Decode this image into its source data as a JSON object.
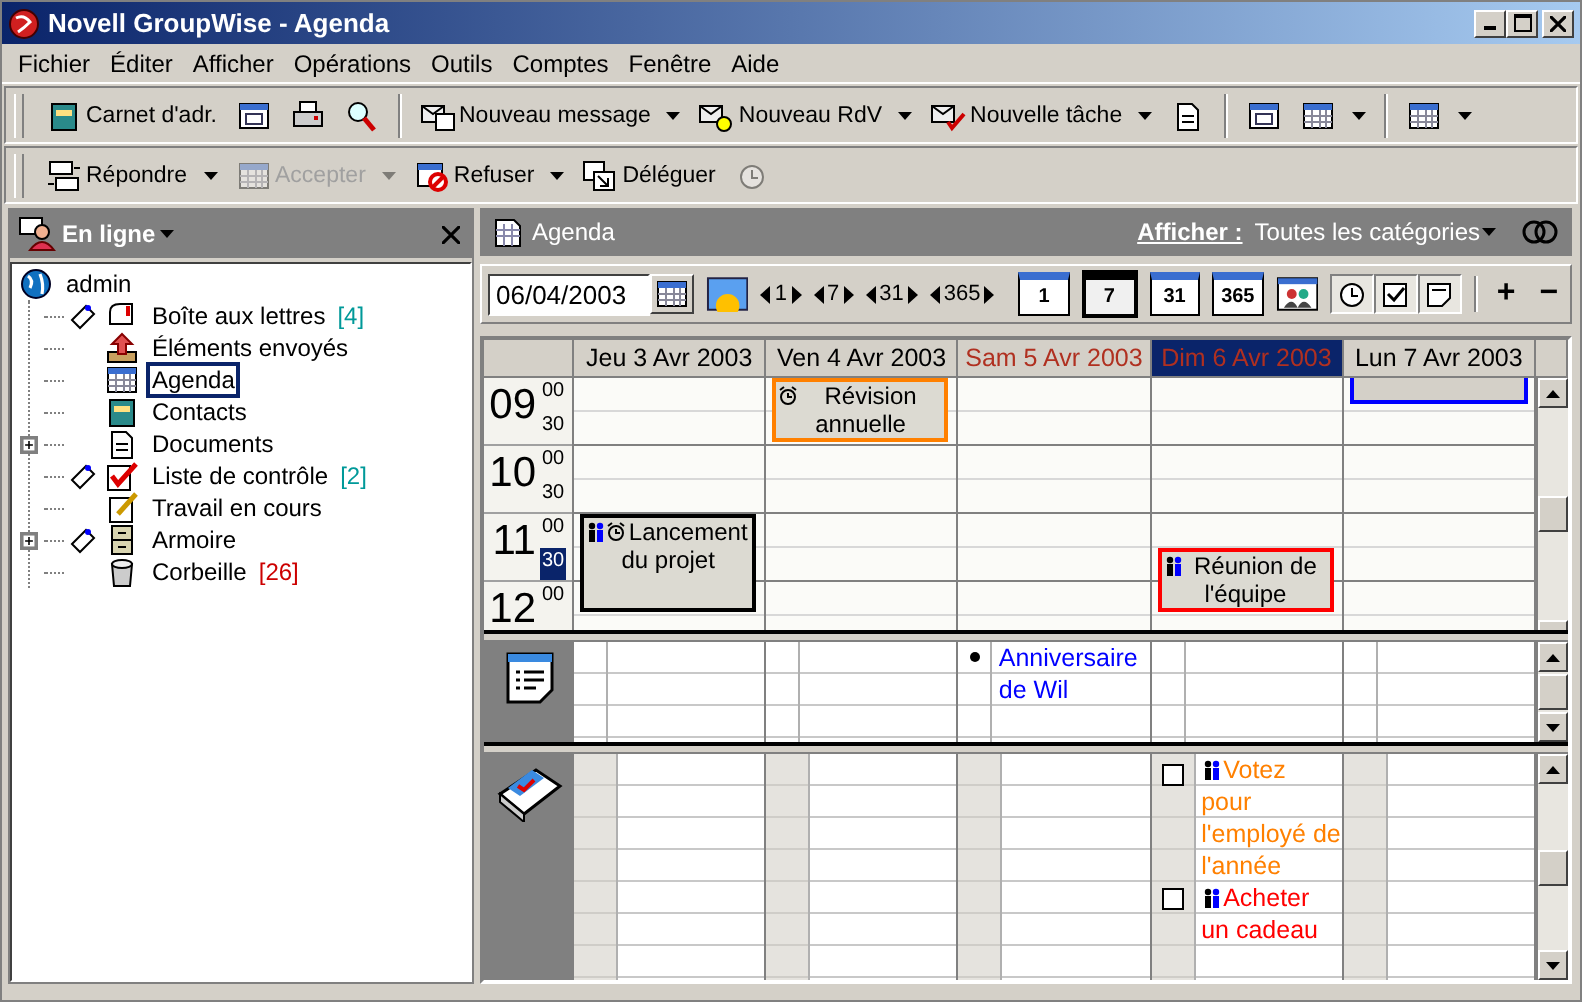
{
  "window": {
    "title": "Novell GroupWise - Agenda"
  },
  "menu": [
    "Fichier",
    "Éditer",
    "Afficher",
    "Opérations",
    "Outils",
    "Comptes",
    "Fenêtre",
    "Aide"
  ],
  "toolbar_1": [
    {
      "kind": "labeled",
      "label": "Carnet d'adr.",
      "dropdown": false
    },
    {
      "kind": "icon",
      "dropdown": false
    },
    {
      "kind": "icon",
      "dropdown": false
    },
    {
      "kind": "icon",
      "dropdown": false
    },
    {
      "kind": "separator"
    },
    {
      "kind": "labeled",
      "label": "Nouveau message",
      "dropdown": true
    },
    {
      "kind": "labeled",
      "label": "Nouveau RdV",
      "dropdown": true
    },
    {
      "kind": "labeled",
      "label": "Nouvelle tâche",
      "dropdown": true
    },
    {
      "kind": "icon",
      "dropdown": false
    },
    {
      "kind": "separator"
    },
    {
      "kind": "icon",
      "dropdown": false
    },
    {
      "kind": "icon",
      "dropdown": true
    },
    {
      "kind": "separator"
    },
    {
      "kind": "icon",
      "dropdown": true
    }
  ],
  "toolbar_2": [
    {
      "kind": "labeled",
      "label": "Répondre",
      "dropdown": true,
      "disabled": false
    },
    {
      "kind": "labeled",
      "label": "Accepter",
      "dropdown": true,
      "disabled": true
    },
    {
      "kind": "labeled",
      "label": "Refuser",
      "dropdown": true,
      "disabled": false
    },
    {
      "kind": "labeled",
      "label": "Déléguer",
      "dropdown": false,
      "disabled": false
    },
    {
      "kind": "icon",
      "dropdown": false,
      "disabled": true
    }
  ],
  "folder_pane": {
    "title": "En ligne",
    "tree": [
      {
        "label": "admin",
        "selected": false,
        "children": [
          {
            "label": "Boîte aux lettres",
            "count": {
              "text": "[4]",
              "color": "#009999"
            },
            "flagged": true,
            "selected": false
          },
          {
            "label": "Éléments envoyés",
            "flagged": false,
            "selected": false
          },
          {
            "label": "Agenda",
            "flagged": false,
            "selected": true
          },
          {
            "label": "Contacts",
            "flagged": false,
            "selected": false
          },
          {
            "label": "Documents",
            "flagged": false,
            "selected": false,
            "expanded": false
          },
          {
            "label": "Liste de contrôle",
            "count": {
              "text": "[2]",
              "color": "#009999"
            },
            "flagged": true,
            "selected": false
          },
          {
            "label": "Travail en cours",
            "flagged": false,
            "selected": false
          },
          {
            "label": "Armoire",
            "flagged": true,
            "selected": false,
            "expanded": false
          },
          {
            "label": "Corbeille",
            "count": {
              "text": "[26]",
              "color": "#cc0000"
            },
            "flagged": false,
            "selected": false
          }
        ]
      }
    ]
  },
  "agenda": {
    "title": "Agenda",
    "filter_label": "Afficher :",
    "filter_value": "Toutes les catégories",
    "date": "06/04/2003",
    "steps": [
      "1",
      "7",
      "31",
      "365"
    ],
    "views": [
      {
        "label": "1",
        "selected": false
      },
      {
        "label": "7",
        "selected": true
      },
      {
        "label": "31",
        "selected": false
      },
      {
        "label": "365",
        "selected": false
      }
    ],
    "toggles": [
      {
        "on": true
      },
      {
        "on": true
      },
      {
        "on": true
      }
    ],
    "zoom_in": "+",
    "zoom_out": "−",
    "hours": [
      {
        "hour": "09",
        "minutes": [
          {
            "text": "00",
            "selected": false
          },
          {
            "text": "30",
            "selected": false
          }
        ]
      },
      {
        "hour": "10",
        "minutes": [
          {
            "text": "00",
            "selected": false
          },
          {
            "text": "30",
            "selected": false
          }
        ]
      },
      {
        "hour": "11",
        "minutes": [
          {
            "text": "00",
            "selected": false
          },
          {
            "text": "30",
            "selected": true
          }
        ]
      },
      {
        "hour": "12",
        "minutes": [
          {
            "text": "00",
            "selected": false
          }
        ]
      }
    ],
    "days": [
      {
        "label": "Jeu 3 Avr 2003",
        "weekend": false,
        "today": false,
        "selected": false,
        "events": [
          {
            "text": "Lancement du projet",
            "color": "#000000",
            "group": true,
            "alarm": true
          }
        ]
      },
      {
        "label": "Ven 4 Avr 2003",
        "weekend": false,
        "today": false,
        "selected": false,
        "events": [
          {
            "text": "Révision annuelle",
            "color": "#ff8000",
            "group": false,
            "alarm": true
          }
        ]
      },
      {
        "label": "Sam 5 Avr 2003",
        "weekend": true,
        "today": false,
        "selected": false,
        "notes": [
          {
            "text": "Anniversaire de Wil"
          }
        ]
      },
      {
        "label": "Dim 6 Avr 2003",
        "weekend": true,
        "today": true,
        "selected": false,
        "events": [
          {
            "text": "Réunion de l'équipe",
            "color": "#ff0000",
            "group": true,
            "alarm": false
          }
        ],
        "tasks": [
          {
            "text": "Votez pour l'employé de l'année",
            "color": "#ff8000",
            "checked": false,
            "group": true
          },
          {
            "text": "Acheter un cadeau",
            "color": "#ff0000",
            "checked": false,
            "group": true
          }
        ]
      },
      {
        "label": "Lun 7 Avr 2003",
        "weekend": false,
        "today": false,
        "selected": true
      }
    ]
  }
}
